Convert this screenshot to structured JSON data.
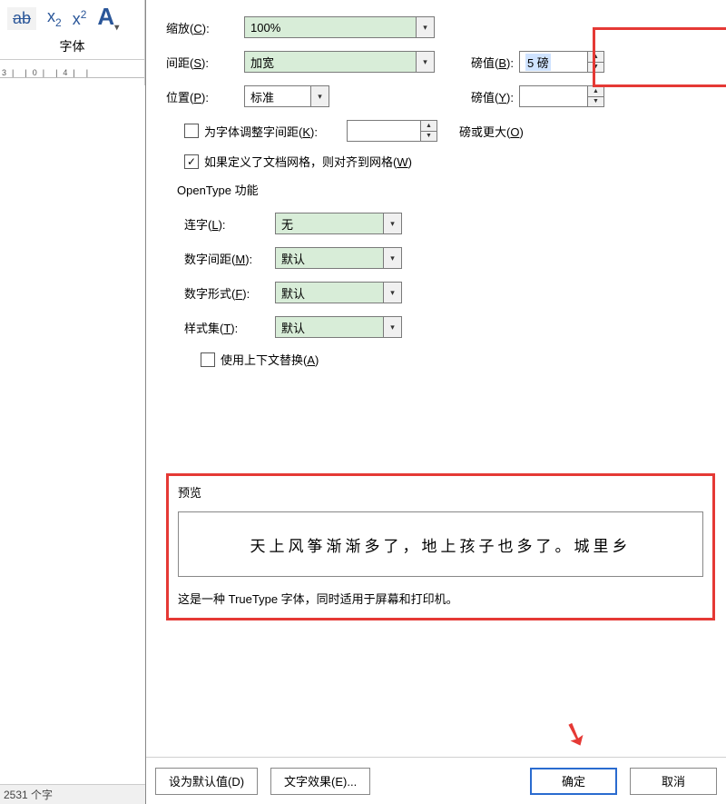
{
  "ribbon": {
    "group_label": "字体",
    "icon_ab": "ab",
    "icon_x": "x"
  },
  "ruler": {
    "marks": [
      "3",
      "1",
      "",
      "1",
      "0",
      "1",
      "",
      "1",
      "4",
      "1",
      "",
      "1"
    ]
  },
  "status": {
    "text": "2531 个字"
  },
  "dialog": {
    "scale": {
      "label": "缩放(",
      "hotkey": "C",
      "label_tail": "):",
      "value": "100%"
    },
    "spacing": {
      "label": "间距(",
      "hotkey": "S",
      "label_tail": "):",
      "value": "加宽",
      "points_label": "磅值(",
      "points_hotkey": "B",
      "points_tail": "):",
      "points_value": "5 磅"
    },
    "position": {
      "label": "位置(",
      "hotkey": "P",
      "label_tail": "):",
      "value": "标准",
      "points_label": "磅值(",
      "points_hotkey": "Y",
      "points_tail": "):",
      "points_value": ""
    },
    "kerning": {
      "chk_label": "为字体调整字间距(",
      "chk_hotkey": "K",
      "chk_tail": "):",
      "value": "",
      "trail": "磅或更大(",
      "trail_hotkey": "O",
      "trail_tail": ")"
    },
    "snapgrid": {
      "label": "如果定义了文档网格，则对齐到网格(",
      "hotkey": "W",
      "tail": ")"
    },
    "opentype": {
      "header": "OpenType 功能",
      "ligatures": {
        "label": "连字(",
        "hotkey": "L",
        "tail": "):",
        "value": "无"
      },
      "numspacing": {
        "label": "数字间距(",
        "hotkey": "M",
        "tail": "):",
        "value": "默认"
      },
      "numforms": {
        "label": "数字形式(",
        "hotkey": "F",
        "tail": "):",
        "value": "默认"
      },
      "styleset": {
        "label": "样式集(",
        "hotkey": "T",
        "tail": "):",
        "value": "默认"
      },
      "contextual": {
        "label": "使用上下文替换(",
        "hotkey": "A",
        "tail": ")"
      }
    },
    "preview": {
      "title": "预览",
      "text": "天上风筝渐渐多了，地上孩子也多了。城里乡",
      "note": "这是一种 TrueType 字体，同时适用于屏幕和打印机。"
    },
    "buttons": {
      "default": "设为默认值(D)",
      "texteffect": "文字效果(E)...",
      "ok": "确定",
      "cancel": "取消"
    }
  }
}
